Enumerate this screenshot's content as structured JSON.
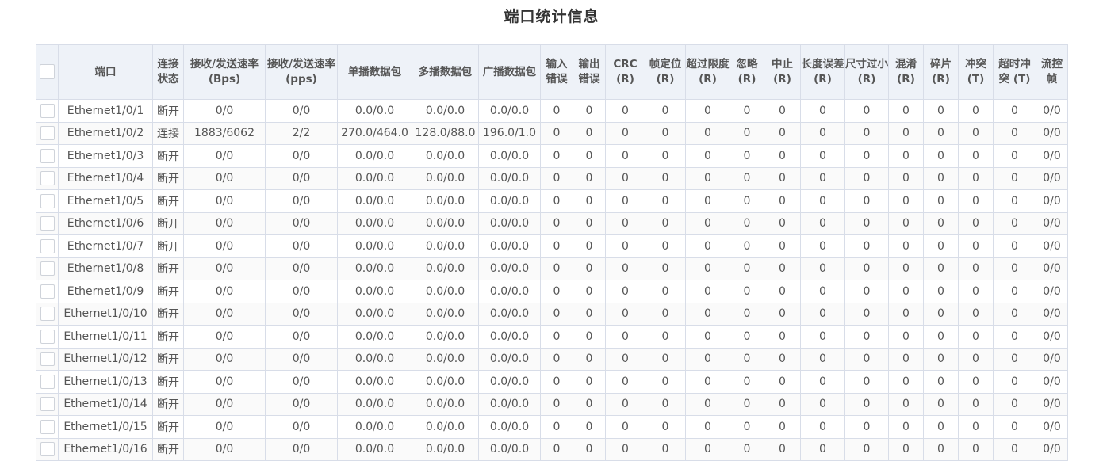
{
  "page": {
    "title": "端口统计信息"
  },
  "table": {
    "headers": [
      "端口",
      "连接状态",
      "接收/发送速率(Bps)",
      "接收/发送速率(pps)",
      "单播数据包",
      "多播数据包",
      "广播数据包",
      "输入错误",
      "输出错误",
      "CRC (R)",
      "帧定位 (R)",
      "超过限度 (R)",
      "忽略 (R)",
      "中止 (R)",
      "长度误差 (R)",
      "尺寸过小 (R)",
      "混淆 (R)",
      "碎片 (R)",
      "冲突 (T)",
      "超时冲突 (T)",
      "流控帧"
    ],
    "rows": [
      [
        "Ethernet1/0/1",
        "断开",
        "0/0",
        "0/0",
        "0.0/0.0",
        "0.0/0.0",
        "0.0/0.0",
        "0",
        "0",
        "0",
        "0",
        "0",
        "0",
        "0",
        "0",
        "0",
        "0",
        "0",
        "0",
        "0",
        "0/0"
      ],
      [
        "Ethernet1/0/2",
        "连接",
        "1883/6062",
        "2/2",
        "270.0/464.0",
        "128.0/88.0",
        "196.0/1.0",
        "0",
        "0",
        "0",
        "0",
        "0",
        "0",
        "0",
        "0",
        "0",
        "0",
        "0",
        "0",
        "0",
        "0/0"
      ],
      [
        "Ethernet1/0/3",
        "断开",
        "0/0",
        "0/0",
        "0.0/0.0",
        "0.0/0.0",
        "0.0/0.0",
        "0",
        "0",
        "0",
        "0",
        "0",
        "0",
        "0",
        "0",
        "0",
        "0",
        "0",
        "0",
        "0",
        "0/0"
      ],
      [
        "Ethernet1/0/4",
        "断开",
        "0/0",
        "0/0",
        "0.0/0.0",
        "0.0/0.0",
        "0.0/0.0",
        "0",
        "0",
        "0",
        "0",
        "0",
        "0",
        "0",
        "0",
        "0",
        "0",
        "0",
        "0",
        "0",
        "0/0"
      ],
      [
        "Ethernet1/0/5",
        "断开",
        "0/0",
        "0/0",
        "0.0/0.0",
        "0.0/0.0",
        "0.0/0.0",
        "0",
        "0",
        "0",
        "0",
        "0",
        "0",
        "0",
        "0",
        "0",
        "0",
        "0",
        "0",
        "0",
        "0/0"
      ],
      [
        "Ethernet1/0/6",
        "断开",
        "0/0",
        "0/0",
        "0.0/0.0",
        "0.0/0.0",
        "0.0/0.0",
        "0",
        "0",
        "0",
        "0",
        "0",
        "0",
        "0",
        "0",
        "0",
        "0",
        "0",
        "0",
        "0",
        "0/0"
      ],
      [
        "Ethernet1/0/7",
        "断开",
        "0/0",
        "0/0",
        "0.0/0.0",
        "0.0/0.0",
        "0.0/0.0",
        "0",
        "0",
        "0",
        "0",
        "0",
        "0",
        "0",
        "0",
        "0",
        "0",
        "0",
        "0",
        "0",
        "0/0"
      ],
      [
        "Ethernet1/0/8",
        "断开",
        "0/0",
        "0/0",
        "0.0/0.0",
        "0.0/0.0",
        "0.0/0.0",
        "0",
        "0",
        "0",
        "0",
        "0",
        "0",
        "0",
        "0",
        "0",
        "0",
        "0",
        "0",
        "0",
        "0/0"
      ],
      [
        "Ethernet1/0/9",
        "断开",
        "0/0",
        "0/0",
        "0.0/0.0",
        "0.0/0.0",
        "0.0/0.0",
        "0",
        "0",
        "0",
        "0",
        "0",
        "0",
        "0",
        "0",
        "0",
        "0",
        "0",
        "0",
        "0",
        "0/0"
      ],
      [
        "Ethernet1/0/10",
        "断开",
        "0/0",
        "0/0",
        "0.0/0.0",
        "0.0/0.0",
        "0.0/0.0",
        "0",
        "0",
        "0",
        "0",
        "0",
        "0",
        "0",
        "0",
        "0",
        "0",
        "0",
        "0",
        "0",
        "0/0"
      ],
      [
        "Ethernet1/0/11",
        "断开",
        "0/0",
        "0/0",
        "0.0/0.0",
        "0.0/0.0",
        "0.0/0.0",
        "0",
        "0",
        "0",
        "0",
        "0",
        "0",
        "0",
        "0",
        "0",
        "0",
        "0",
        "0",
        "0",
        "0/0"
      ],
      [
        "Ethernet1/0/12",
        "断开",
        "0/0",
        "0/0",
        "0.0/0.0",
        "0.0/0.0",
        "0.0/0.0",
        "0",
        "0",
        "0",
        "0",
        "0",
        "0",
        "0",
        "0",
        "0",
        "0",
        "0",
        "0",
        "0",
        "0/0"
      ],
      [
        "Ethernet1/0/13",
        "断开",
        "0/0",
        "0/0",
        "0.0/0.0",
        "0.0/0.0",
        "0.0/0.0",
        "0",
        "0",
        "0",
        "0",
        "0",
        "0",
        "0",
        "0",
        "0",
        "0",
        "0",
        "0",
        "0",
        "0/0"
      ],
      [
        "Ethernet1/0/14",
        "断开",
        "0/0",
        "0/0",
        "0.0/0.0",
        "0.0/0.0",
        "0.0/0.0",
        "0",
        "0",
        "0",
        "0",
        "0",
        "0",
        "0",
        "0",
        "0",
        "0",
        "0",
        "0",
        "0",
        "0/0"
      ],
      [
        "Ethernet1/0/15",
        "断开",
        "0/0",
        "0/0",
        "0.0/0.0",
        "0.0/0.0",
        "0.0/0.0",
        "0",
        "0",
        "0",
        "0",
        "0",
        "0",
        "0",
        "0",
        "0",
        "0",
        "0",
        "0",
        "0",
        "0/0"
      ],
      [
        "Ethernet1/0/16",
        "断开",
        "0/0",
        "0/0",
        "0.0/0.0",
        "0.0/0.0",
        "0.0/0.0",
        "0",
        "0",
        "0",
        "0",
        "0",
        "0",
        "0",
        "0",
        "0",
        "0",
        "0",
        "0",
        "0",
        "0/0"
      ]
    ]
  }
}
